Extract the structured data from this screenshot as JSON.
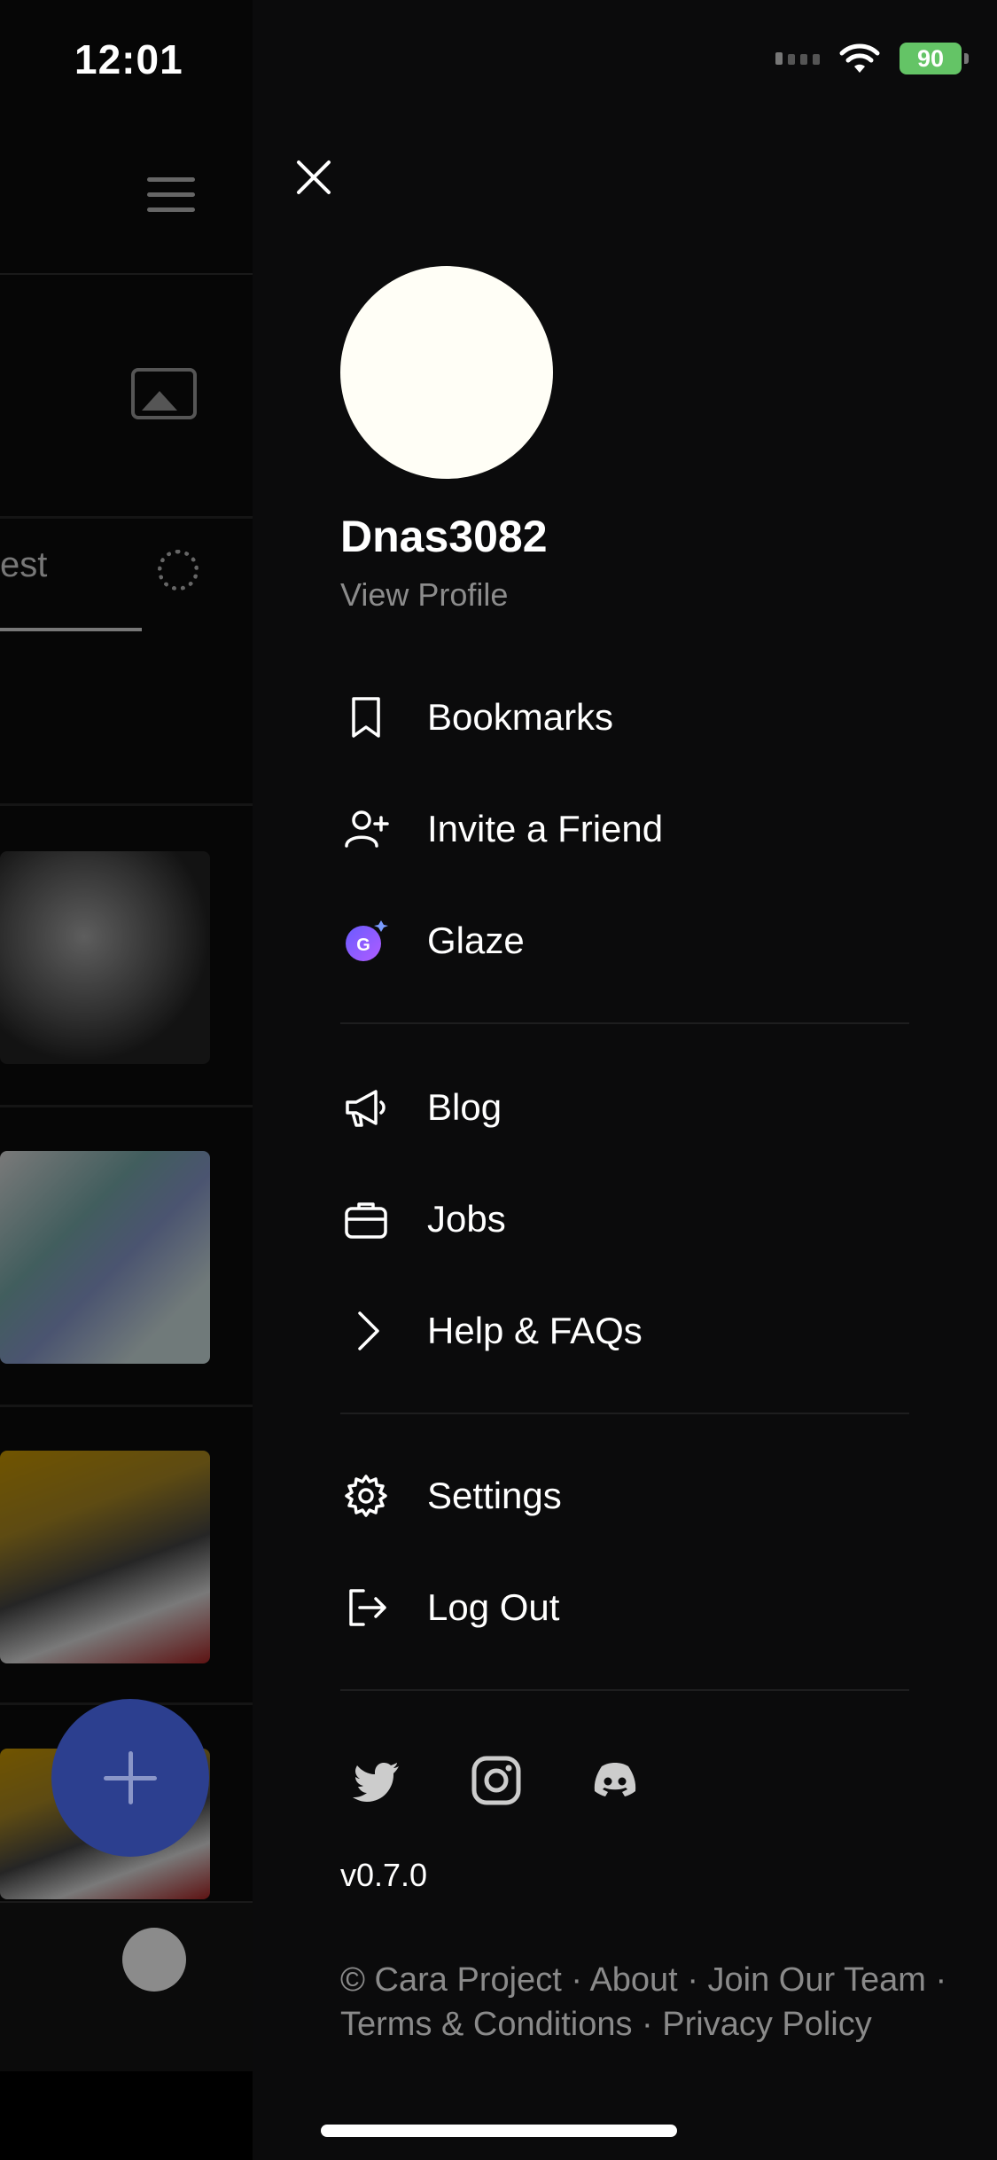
{
  "status_bar": {
    "time": "12:01",
    "battery": "90"
  },
  "background": {
    "tab_label": "est"
  },
  "drawer": {
    "username": "Dnas3082",
    "view_profile": "View Profile",
    "group1": [
      {
        "label": "Bookmarks",
        "icon": "bookmark-icon"
      },
      {
        "label": "Invite a Friend",
        "icon": "user-plus-icon"
      },
      {
        "label": "Glaze",
        "icon": "glaze-icon"
      }
    ],
    "group2": [
      {
        "label": "Blog",
        "icon": "megaphone-icon"
      },
      {
        "label": "Jobs",
        "icon": "briefcase-icon"
      },
      {
        "label": "Help & FAQs",
        "icon": "chevron-right-icon"
      }
    ],
    "group3": [
      {
        "label": "Settings",
        "icon": "gear-icon"
      },
      {
        "label": "Log Out",
        "icon": "logout-icon"
      }
    ],
    "socials": [
      "twitter-icon",
      "instagram-icon",
      "discord-icon"
    ],
    "version": "v0.7.0",
    "footer": {
      "copyright": "© Cara Project",
      "about": "About",
      "join": "Join Our Team",
      "terms": "Terms & Conditions",
      "privacy": "Privacy Policy",
      "separator": "·"
    }
  },
  "colors": {
    "drawer_bg": "#0b0b0c",
    "fab": "#2c3f8f",
    "glaze_gradient_start": "#6a5cff",
    "glaze_gradient_end": "#b05cff",
    "battery": "#64c466"
  }
}
